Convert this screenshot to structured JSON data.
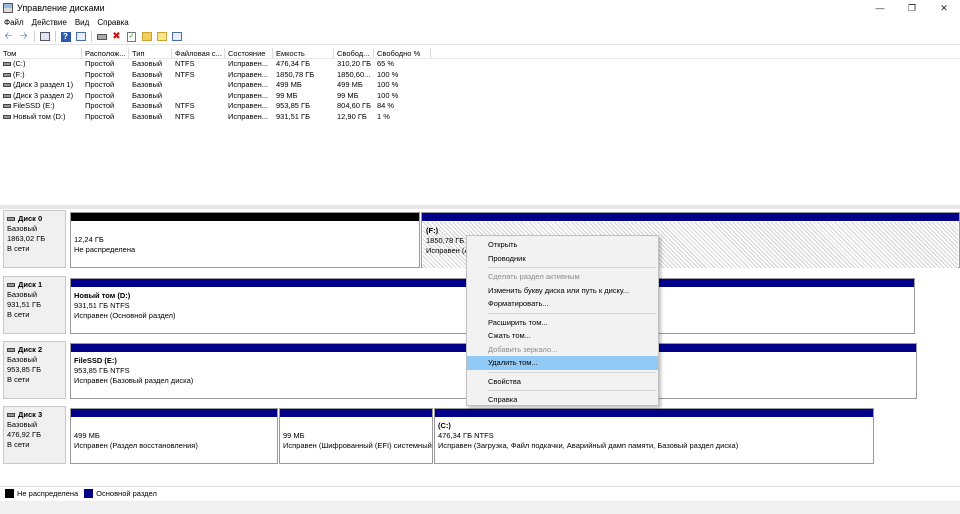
{
  "window": {
    "title": "Управление дисками",
    "minimize_icon": "minimize-icon",
    "maximize_icon": "restore-icon",
    "close_icon": "close-icon"
  },
  "menu": [
    "Файл",
    "Действие",
    "Вид",
    "Справка"
  ],
  "list": {
    "headers": [
      "Том",
      "Располож...",
      "Тип",
      "Файловая с...",
      "Состояние",
      "Емкость",
      "Свобод...",
      "Свободно %"
    ],
    "rows": [
      [
        "(C:)",
        "Простой",
        "Базовый",
        "NTFS",
        "Исправен...",
        "476,34 ГБ",
        "310,20 ГБ",
        "65 %"
      ],
      [
        "(F:)",
        "Простой",
        "Базовый",
        "NTFS",
        "Исправен...",
        "1850,78 ГБ",
        "1850,60...",
        "100 %"
      ],
      [
        "(Диск 3 раздел 1)",
        "Простой",
        "Базовый",
        "",
        "Исправен...",
        "499 МБ",
        "499 МБ",
        "100 %"
      ],
      [
        "(Диск 3 раздел 2)",
        "Простой",
        "Базовый",
        "",
        "Исправен...",
        "99 МБ",
        "99 МБ",
        "100 %"
      ],
      [
        "FileSSD (E:)",
        "Простой",
        "Базовый",
        "NTFS",
        "Исправен...",
        "953,85 ГБ",
        "804,60 ГБ",
        "84 %"
      ],
      [
        "Новый том (D:)",
        "Простой",
        "Базовый",
        "NTFS",
        "Исправен...",
        "931,51 ГБ",
        "12,90 ГБ",
        "1 %"
      ]
    ]
  },
  "disks": [
    {
      "name": "Диск 0",
      "type": "Базовый",
      "size": "1863,02 ГБ",
      "status": "В сети",
      "partitions": [
        {
          "name": "",
          "line1": "12,24 ГБ",
          "line2": "Не распределена"
        },
        {
          "name": "(F:)",
          "line1": "1850,78 ГБ N",
          "line2": "Исправен (А"
        }
      ]
    },
    {
      "name": "Диск 1",
      "type": "Базовый",
      "size": "931,51 ГБ",
      "status": "В сети",
      "partitions": [
        {
          "name": "Новый том  (D:)",
          "line1": "931,51 ГБ NTFS",
          "line2": "Исправен (Основной раздел)"
        }
      ]
    },
    {
      "name": "Диск 2",
      "type": "Базовый",
      "size": "953,85 ГБ",
      "status": "В сети",
      "partitions": [
        {
          "name": "FileSSD  (E:)",
          "line1": "953,85 ГБ NTFS",
          "line2": "Исправен (Базовый раздел диска)"
        }
      ]
    },
    {
      "name": "Диск 3",
      "type": "Базовый",
      "size": "476,92 ГБ",
      "status": "В сети",
      "partitions": [
        {
          "name": "",
          "line1": "499 МБ",
          "line2": "Исправен (Раздел восстановления)"
        },
        {
          "name": "",
          "line1": "99 МБ",
          "line2": "Исправен (Шифрованный (EFI) системный"
        },
        {
          "name": "(C:)",
          "line1": "476,34 ГБ NTFS",
          "line2": "Исправен (Загрузка, Файл подкачки, Аварийный дамп памяти, Базовый раздел диска)"
        }
      ]
    }
  ],
  "legend": [
    {
      "label": "Не распределена",
      "color": "#000000"
    },
    {
      "label": "Основной раздел",
      "color": "#00008a"
    }
  ],
  "context_menu": [
    {
      "label": "Открыть",
      "disabled": false
    },
    {
      "label": "Проводник",
      "disabled": false
    },
    {
      "sep": true
    },
    {
      "label": "Сделать раздел активным",
      "disabled": true
    },
    {
      "label": "Изменить букву диска или путь к диску...",
      "disabled": false
    },
    {
      "label": "Форматировать...",
      "disabled": false
    },
    {
      "sep": true
    },
    {
      "label": "Расширить том...",
      "disabled": false
    },
    {
      "label": "Сжать том...",
      "disabled": false
    },
    {
      "label": "Добавить зеркало...",
      "disabled": true
    },
    {
      "label": "Удалить том...",
      "disabled": false,
      "highlight": true
    },
    {
      "sep": true
    },
    {
      "label": "Свойства",
      "disabled": false
    },
    {
      "sep": true
    },
    {
      "label": "Справка",
      "disabled": false
    }
  ]
}
